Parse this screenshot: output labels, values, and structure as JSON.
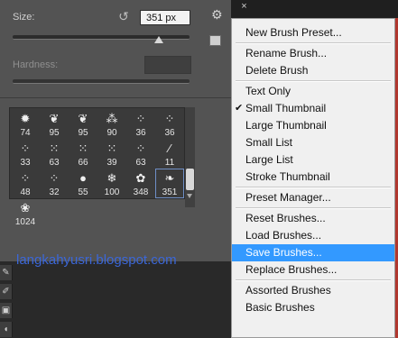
{
  "panel": {
    "size_label": "Size:",
    "size_value": "351 px",
    "size_slider_level": 0.81,
    "hardness_label": "Hardness:",
    "hardness_value": "",
    "brushes": [
      {
        "size": "74",
        "icon": "star-leaf-icon"
      },
      {
        "size": "95",
        "icon": "leaf-icon"
      },
      {
        "size": "95",
        "icon": "leaf-icon"
      },
      {
        "size": "90",
        "icon": "splatter-icon"
      },
      {
        "size": "36",
        "icon": "grass-icon"
      },
      {
        "size": "36",
        "icon": "grass-icon"
      },
      {
        "size": "33",
        "icon": "grass-icon"
      },
      {
        "size": "63",
        "icon": "speckle-icon"
      },
      {
        "size": "66",
        "icon": "speckle-icon"
      },
      {
        "size": "39",
        "icon": "speckle-icon"
      },
      {
        "size": "63",
        "icon": "grass-icon"
      },
      {
        "size": "11",
        "icon": "stroke-icon"
      },
      {
        "size": "48",
        "icon": "grass-icon"
      },
      {
        "size": "32",
        "icon": "grass-icon"
      },
      {
        "size": "55",
        "icon": "round-brush-icon"
      },
      {
        "size": "100",
        "icon": "snowflake-icon"
      },
      {
        "size": "348",
        "icon": "medallion-icon"
      },
      {
        "size": "351",
        "icon": "ornament-icon",
        "selected": true
      },
      {
        "size": "1024",
        "icon": "custom-brush-icon"
      }
    ]
  },
  "watermark": "langkahyusri.blogspot.com",
  "menu": {
    "items": [
      {
        "label": "New Brush Preset..."
      },
      {
        "label": "Rename Brush..."
      },
      {
        "label": "Delete Brush"
      },
      {
        "label": "Text Only"
      },
      {
        "label": "Small Thumbnail",
        "checked": true
      },
      {
        "label": "Large Thumbnail"
      },
      {
        "label": "Small List"
      },
      {
        "label": "Large List"
      },
      {
        "label": "Stroke Thumbnail"
      },
      {
        "label": "Preset Manager..."
      },
      {
        "label": "Reset Brushes..."
      },
      {
        "label": "Load Brushes..."
      },
      {
        "label": "Save Brushes...",
        "highlighted": true
      },
      {
        "label": "Replace Brushes..."
      },
      {
        "label": "Assorted Brushes"
      },
      {
        "label": "Basic Brushes"
      }
    ],
    "highlight_color": "#3399ff"
  },
  "colors": {
    "panel_bg": "#535353",
    "accent": "#3399ff",
    "watermark": "#3b67d8"
  }
}
